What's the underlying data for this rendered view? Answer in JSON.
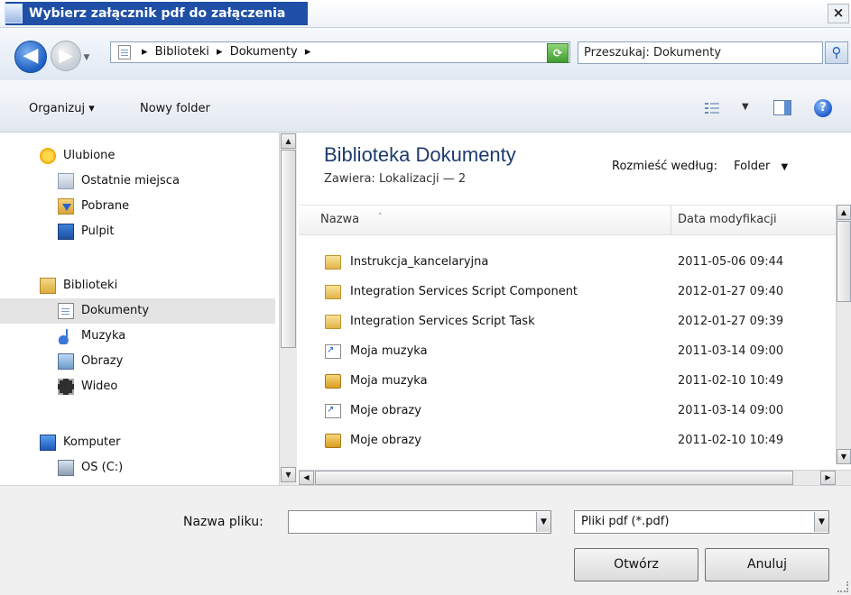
{
  "window": {
    "title": "Wybierz załącznik pdf do załączenia",
    "close_label": "×"
  },
  "nav": {
    "breadcrumbs": [
      "Biblioteki",
      "Dokumenty"
    ],
    "search_placeholder": "Przeszukaj: Dokumenty"
  },
  "toolbar": {
    "organize_label": "Organizuj ▾",
    "new_folder_label": "Nowy folder"
  },
  "sidebar": {
    "favorites": {
      "label": "Ulubione",
      "items": [
        "Ostatnie miejsca",
        "Pobrane",
        "Pulpit"
      ]
    },
    "libraries": {
      "label": "Biblioteki",
      "items": [
        "Dokumenty",
        "Muzyka",
        "Obrazy",
        "Wideo"
      ],
      "selected": "Dokumenty"
    },
    "computer": {
      "label": "Komputer",
      "items": [
        "OS (C:)"
      ]
    }
  },
  "content": {
    "title": "Biblioteka Dokumenty",
    "subtitle": "Zawiera:  Lokalizacji — 2",
    "arrange_label": "Rozmieść według:",
    "arrange_value": "Folder",
    "columns": {
      "name": "Nazwa",
      "date": "Data modyfikacji"
    },
    "files": [
      {
        "name": "Instrukcja_kancelaryjna",
        "date": "2011-05-06 09:44",
        "icon": "folder-icon"
      },
      {
        "name": "Integration Services Script Component",
        "date": "2012-01-27 09:40",
        "icon": "folder-icon"
      },
      {
        "name": "Integration Services Script Task",
        "date": "2012-01-27 09:39",
        "icon": "folder-icon"
      },
      {
        "name": "Moja muzyka",
        "date": "2011-03-14 09:00",
        "icon": "shortcut-icon"
      },
      {
        "name": "Moja muzyka",
        "date": "2011-02-10 10:49",
        "icon": "locked-folder-icon"
      },
      {
        "name": "Moje obrazy",
        "date": "2011-03-14 09:00",
        "icon": "shortcut-icon"
      },
      {
        "name": "Moje obrazy",
        "date": "2011-02-10 10:49",
        "icon": "locked-folder-icon"
      }
    ]
  },
  "bottom": {
    "filename_label": "Nazwa pliku:",
    "filename_value": "",
    "filetype_value": "Pliki pdf (*.pdf)",
    "open_label": "Otwórz",
    "cancel_label": "Anuluj"
  }
}
